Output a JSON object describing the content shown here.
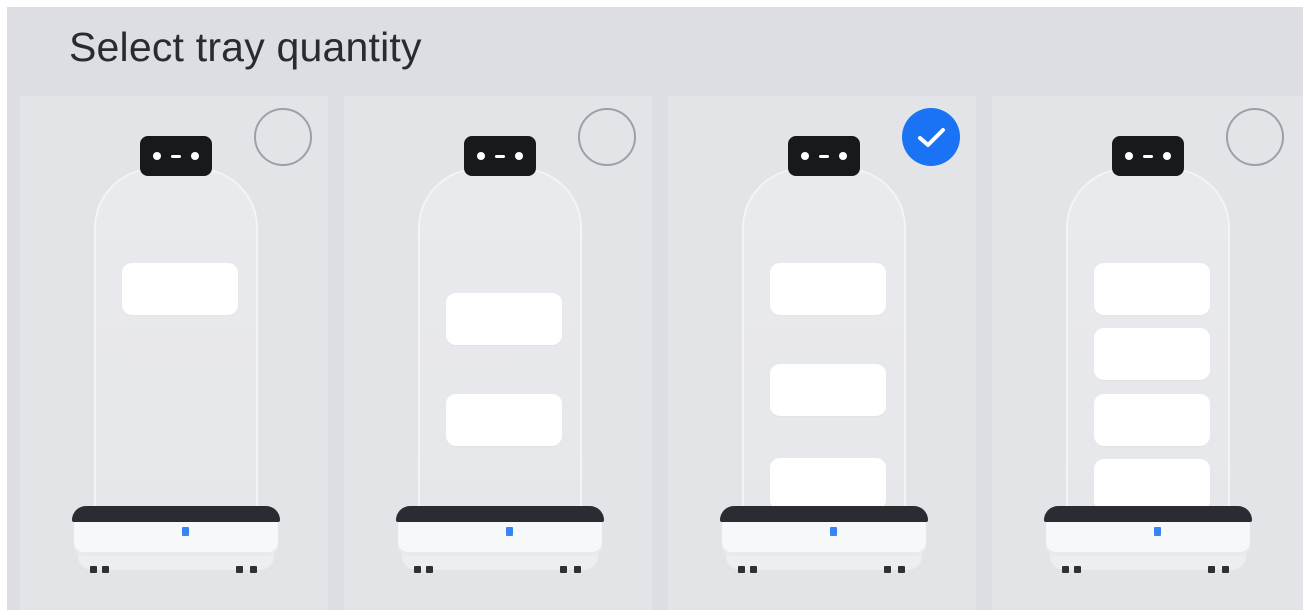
{
  "title": "Select tray quantity",
  "accent_color": "#1a73f5",
  "options": [
    {
      "id": "1-tray",
      "trays": 1,
      "selected": false
    },
    {
      "id": "2-trays",
      "trays": 2,
      "selected": false
    },
    {
      "id": "3-trays",
      "trays": 3,
      "selected": true
    },
    {
      "id": "4-trays",
      "trays": 4,
      "selected": false
    }
  ],
  "icons": {
    "unselected": "radio-empty-icon",
    "selected": "checkmark-icon"
  }
}
